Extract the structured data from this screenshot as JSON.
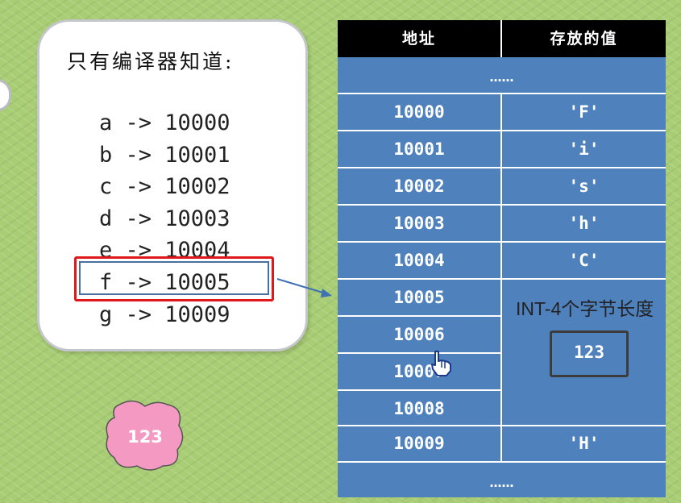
{
  "callout": {
    "title": "只有编译器知道:",
    "mappings": [
      "a -> 10000",
      "b -> 10001",
      "c -> 10002",
      "d -> 10003",
      "e -> 10004",
      "f -> 10005",
      "g -> 10009"
    ],
    "highlighted_line": "f -> 10005"
  },
  "table": {
    "headers": [
      "地址",
      "存放的值"
    ],
    "ellipsis": "……",
    "rows": [
      {
        "address": "10000",
        "value": "'F'"
      },
      {
        "address": "10001",
        "value": "'i'"
      },
      {
        "address": "10002",
        "value": "'s'"
      },
      {
        "address": "10003",
        "value": "'h'"
      },
      {
        "address": "10004",
        "value": "'C'"
      },
      {
        "address": "10005",
        "value": ""
      },
      {
        "address": "10006",
        "value": ""
      },
      {
        "address": "10007",
        "value": ""
      },
      {
        "address": "10008",
        "value": ""
      },
      {
        "address": "10009",
        "value": "'H'"
      }
    ],
    "int_note": "INT-4个字节长度",
    "int_value": "123"
  },
  "blob_value": "123",
  "colors": {
    "table_blue": "#4f81bd",
    "highlight_red": "#e0181b",
    "blob_pink": "#f49ac2",
    "background_green": "#a8cd74"
  }
}
